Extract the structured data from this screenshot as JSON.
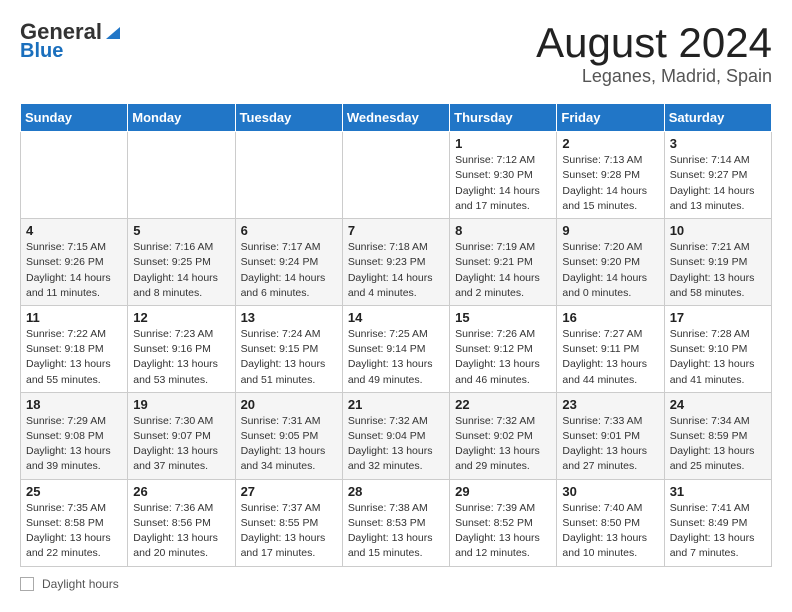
{
  "logo": {
    "line1": "General",
    "line2": "Blue"
  },
  "title": "August 2024",
  "subtitle": "Leganes, Madrid, Spain",
  "days_of_week": [
    "Sunday",
    "Monday",
    "Tuesday",
    "Wednesday",
    "Thursday",
    "Friday",
    "Saturday"
  ],
  "weeks": [
    [
      {
        "day": "",
        "info": ""
      },
      {
        "day": "",
        "info": ""
      },
      {
        "day": "",
        "info": ""
      },
      {
        "day": "",
        "info": ""
      },
      {
        "day": "1",
        "info": "Sunrise: 7:12 AM\nSunset: 9:30 PM\nDaylight: 14 hours and 17 minutes."
      },
      {
        "day": "2",
        "info": "Sunrise: 7:13 AM\nSunset: 9:28 PM\nDaylight: 14 hours and 15 minutes."
      },
      {
        "day": "3",
        "info": "Sunrise: 7:14 AM\nSunset: 9:27 PM\nDaylight: 14 hours and 13 minutes."
      }
    ],
    [
      {
        "day": "4",
        "info": "Sunrise: 7:15 AM\nSunset: 9:26 PM\nDaylight: 14 hours and 11 minutes."
      },
      {
        "day": "5",
        "info": "Sunrise: 7:16 AM\nSunset: 9:25 PM\nDaylight: 14 hours and 8 minutes."
      },
      {
        "day": "6",
        "info": "Sunrise: 7:17 AM\nSunset: 9:24 PM\nDaylight: 14 hours and 6 minutes."
      },
      {
        "day": "7",
        "info": "Sunrise: 7:18 AM\nSunset: 9:23 PM\nDaylight: 14 hours and 4 minutes."
      },
      {
        "day": "8",
        "info": "Sunrise: 7:19 AM\nSunset: 9:21 PM\nDaylight: 14 hours and 2 minutes."
      },
      {
        "day": "9",
        "info": "Sunrise: 7:20 AM\nSunset: 9:20 PM\nDaylight: 14 hours and 0 minutes."
      },
      {
        "day": "10",
        "info": "Sunrise: 7:21 AM\nSunset: 9:19 PM\nDaylight: 13 hours and 58 minutes."
      }
    ],
    [
      {
        "day": "11",
        "info": "Sunrise: 7:22 AM\nSunset: 9:18 PM\nDaylight: 13 hours and 55 minutes."
      },
      {
        "day": "12",
        "info": "Sunrise: 7:23 AM\nSunset: 9:16 PM\nDaylight: 13 hours and 53 minutes."
      },
      {
        "day": "13",
        "info": "Sunrise: 7:24 AM\nSunset: 9:15 PM\nDaylight: 13 hours and 51 minutes."
      },
      {
        "day": "14",
        "info": "Sunrise: 7:25 AM\nSunset: 9:14 PM\nDaylight: 13 hours and 49 minutes."
      },
      {
        "day": "15",
        "info": "Sunrise: 7:26 AM\nSunset: 9:12 PM\nDaylight: 13 hours and 46 minutes."
      },
      {
        "day": "16",
        "info": "Sunrise: 7:27 AM\nSunset: 9:11 PM\nDaylight: 13 hours and 44 minutes."
      },
      {
        "day": "17",
        "info": "Sunrise: 7:28 AM\nSunset: 9:10 PM\nDaylight: 13 hours and 41 minutes."
      }
    ],
    [
      {
        "day": "18",
        "info": "Sunrise: 7:29 AM\nSunset: 9:08 PM\nDaylight: 13 hours and 39 minutes."
      },
      {
        "day": "19",
        "info": "Sunrise: 7:30 AM\nSunset: 9:07 PM\nDaylight: 13 hours and 37 minutes."
      },
      {
        "day": "20",
        "info": "Sunrise: 7:31 AM\nSunset: 9:05 PM\nDaylight: 13 hours and 34 minutes."
      },
      {
        "day": "21",
        "info": "Sunrise: 7:32 AM\nSunset: 9:04 PM\nDaylight: 13 hours and 32 minutes."
      },
      {
        "day": "22",
        "info": "Sunrise: 7:32 AM\nSunset: 9:02 PM\nDaylight: 13 hours and 29 minutes."
      },
      {
        "day": "23",
        "info": "Sunrise: 7:33 AM\nSunset: 9:01 PM\nDaylight: 13 hours and 27 minutes."
      },
      {
        "day": "24",
        "info": "Sunrise: 7:34 AM\nSunset: 8:59 PM\nDaylight: 13 hours and 25 minutes."
      }
    ],
    [
      {
        "day": "25",
        "info": "Sunrise: 7:35 AM\nSunset: 8:58 PM\nDaylight: 13 hours and 22 minutes."
      },
      {
        "day": "26",
        "info": "Sunrise: 7:36 AM\nSunset: 8:56 PM\nDaylight: 13 hours and 20 minutes."
      },
      {
        "day": "27",
        "info": "Sunrise: 7:37 AM\nSunset: 8:55 PM\nDaylight: 13 hours and 17 minutes."
      },
      {
        "day": "28",
        "info": "Sunrise: 7:38 AM\nSunset: 8:53 PM\nDaylight: 13 hours and 15 minutes."
      },
      {
        "day": "29",
        "info": "Sunrise: 7:39 AM\nSunset: 8:52 PM\nDaylight: 13 hours and 12 minutes."
      },
      {
        "day": "30",
        "info": "Sunrise: 7:40 AM\nSunset: 8:50 PM\nDaylight: 13 hours and 10 minutes."
      },
      {
        "day": "31",
        "info": "Sunrise: 7:41 AM\nSunset: 8:49 PM\nDaylight: 13 hours and 7 minutes."
      }
    ]
  ],
  "footer": {
    "label": "Daylight hours"
  }
}
